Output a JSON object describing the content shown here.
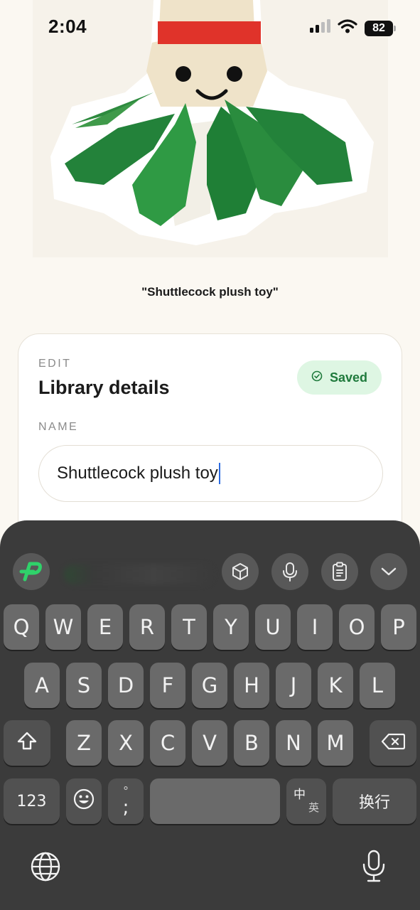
{
  "status_bar": {
    "time": "2:04",
    "battery": "82"
  },
  "caption": "\"Shuttlecock plush toy\"",
  "card": {
    "eyebrow": "EDIT",
    "title": "Library details",
    "saved_label": "Saved",
    "name_label": "NAME",
    "name_value": "Shuttlecock plush toy"
  },
  "keyboard": {
    "toolbar_icons": [
      "app-logo-icon",
      "cube-icon",
      "mic-icon",
      "clipboard-icon",
      "chevron-down-icon"
    ],
    "row1": [
      "Q",
      "W",
      "E",
      "R",
      "T",
      "Y",
      "U",
      "I",
      "O",
      "P"
    ],
    "row2": [
      "A",
      "S",
      "D",
      "F",
      "G",
      "H",
      "J",
      "K",
      "L"
    ],
    "row3": [
      "Z",
      "X",
      "C",
      "V",
      "B",
      "N",
      "M"
    ],
    "numbers_key": "123",
    "punct_top": "°",
    "punct_bottom": ";",
    "lang_top": "中",
    "lang_bottom": "英",
    "return_key": "换行"
  },
  "colors": {
    "accent_green": "#1f7a3c",
    "badge_bg": "#def6e3",
    "caret": "#2b6be0",
    "keyboard_bg": "#3b3b3b"
  }
}
